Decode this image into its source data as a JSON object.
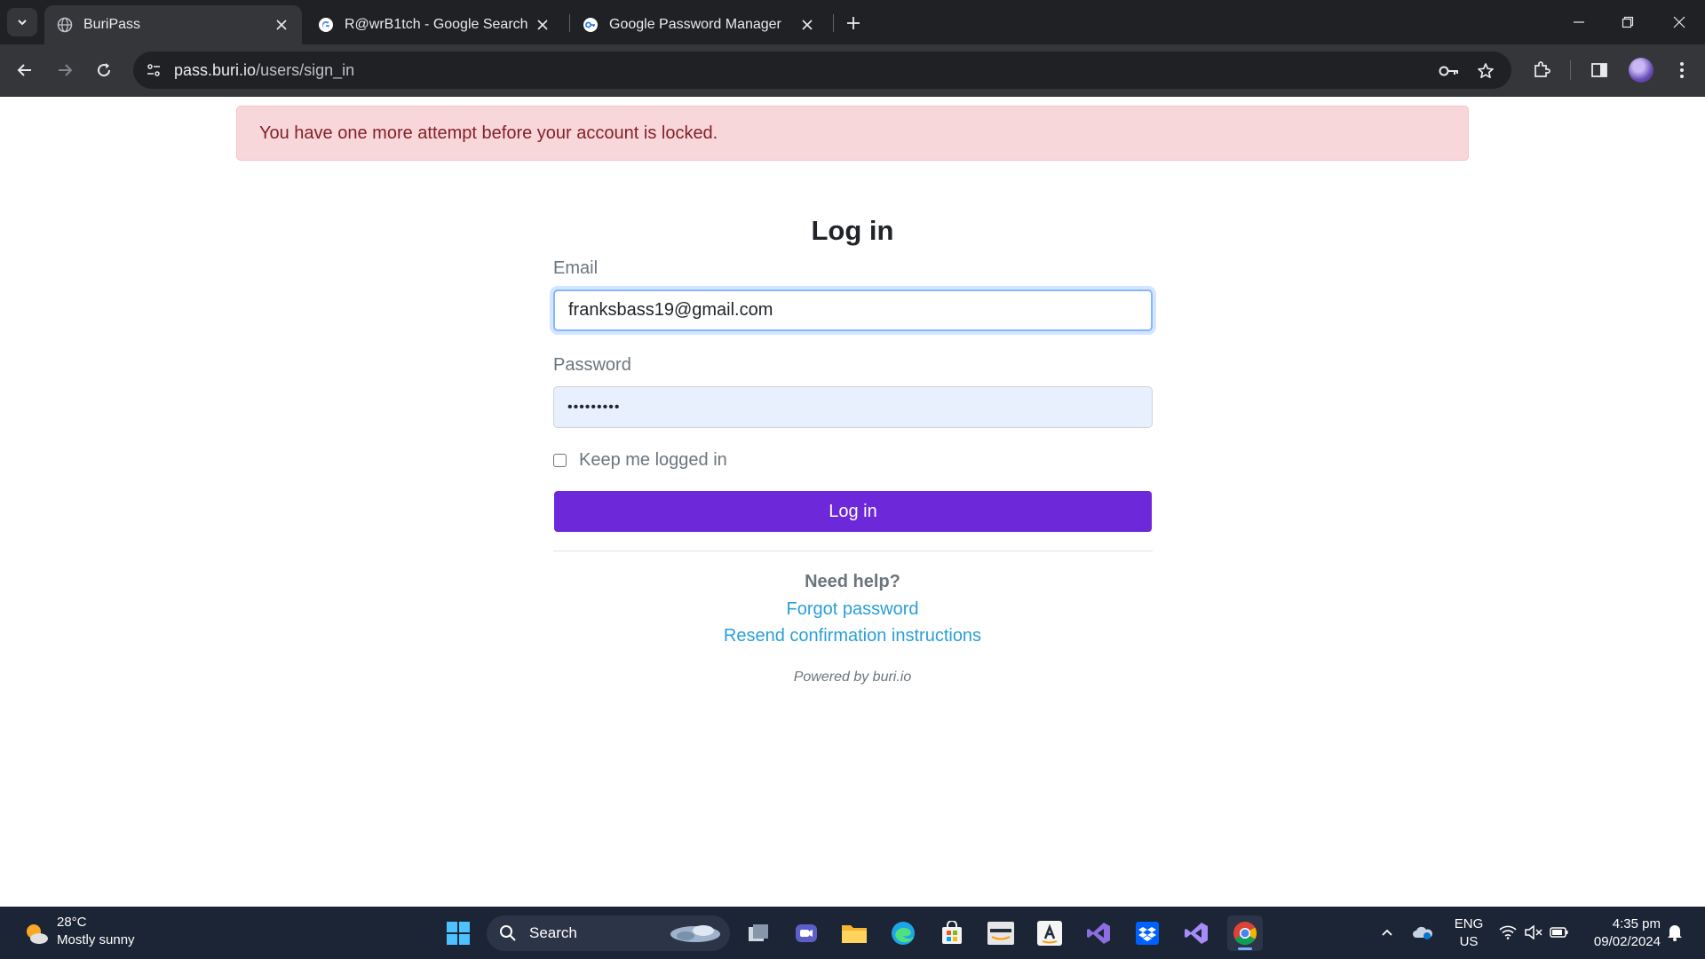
{
  "browser": {
    "tabs": [
      {
        "title": "BuriPass",
        "active": true
      },
      {
        "title": "R@wrB1tch - Google Search",
        "active": false
      },
      {
        "title": "Google Password Manager",
        "active": false
      }
    ],
    "url_host": "pass.buri.io",
    "url_path": "/users/sign_in"
  },
  "page": {
    "alert": "You have one more attempt before your account is locked.",
    "title": "Log in",
    "email_label": "Email",
    "email_value": "franksbass19@gmail.com",
    "password_label": "Password",
    "password_value": "•••••••••",
    "remember_label": "Keep me logged in",
    "remember_checked": false,
    "submit_label": "Log in",
    "help_title": "Need help?",
    "forgot_link": "Forgot password",
    "resend_link": "Resend confirmation instructions",
    "powered_by": "Powered by buri.io"
  },
  "taskbar": {
    "weather_temp": "28°C",
    "weather_desc": "Mostly sunny",
    "search_label": "Search",
    "lang_line1": "ENG",
    "lang_line2": "US",
    "time": "4:35 pm",
    "date": "09/02/2024"
  },
  "colors": {
    "alert_bg": "#f8d7da",
    "alert_text": "#842029",
    "primary_button": "#6d28d9",
    "link": "#2a9fd6",
    "chrome_dark": "#202124",
    "taskbar_bg": "#1c2536"
  }
}
